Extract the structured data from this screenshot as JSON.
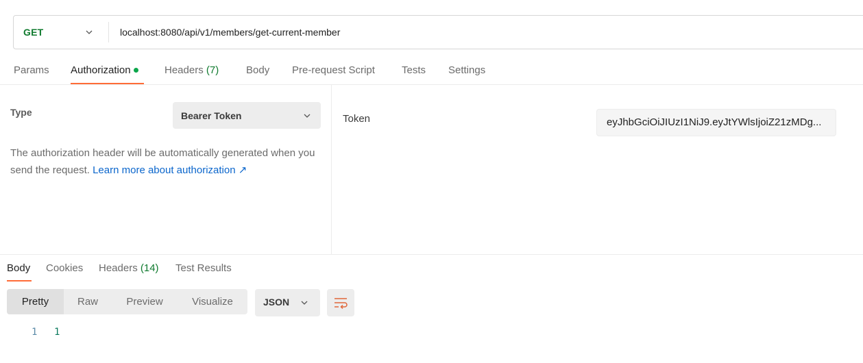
{
  "request": {
    "method": "GET",
    "url": "localhost:8080/api/v1/members/get-current-member"
  },
  "request_tabs": [
    {
      "label": "Params"
    },
    {
      "label": "Authorization"
    },
    {
      "label": "Headers",
      "count": "(7)"
    },
    {
      "label": "Body"
    },
    {
      "label": "Pre-request Script"
    },
    {
      "label": "Tests"
    },
    {
      "label": "Settings"
    }
  ],
  "auth": {
    "type_label": "Type",
    "type_value": "Bearer Token",
    "description": "The authorization header will be automatically generated when you send the request.",
    "link_text": "Learn more about authorization ↗",
    "token_label": "Token",
    "token_value": "eyJhbGciOiJIUzI1NiJ9.eyJtYWlsIjoiZ21zMDg..."
  },
  "response_tabs": [
    {
      "label": "Body"
    },
    {
      "label": "Cookies"
    },
    {
      "label": "Headers",
      "count": "(14)"
    },
    {
      "label": "Test Results"
    }
  ],
  "view_modes": [
    "Pretty",
    "Raw",
    "Preview",
    "Visualize"
  ],
  "format": "JSON",
  "response_body": {
    "line_number": "1",
    "content": "1"
  },
  "colors": {
    "accent": "#ff6c37",
    "method_green": "#0f7a2e",
    "link_blue": "#0b66cc"
  }
}
